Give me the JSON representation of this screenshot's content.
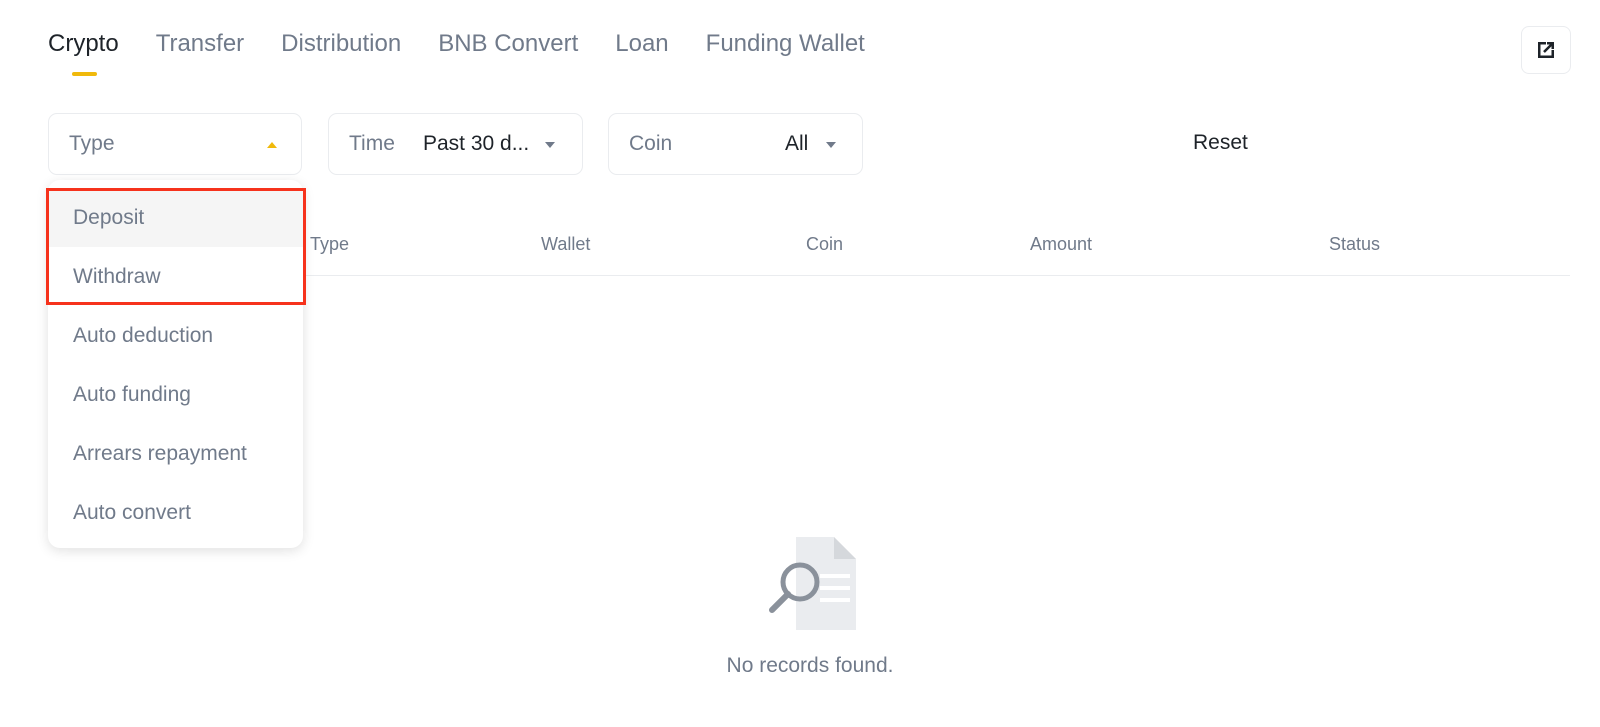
{
  "tabs": [
    {
      "label": "Crypto",
      "active": true
    },
    {
      "label": "Transfer",
      "active": false
    },
    {
      "label": "Distribution",
      "active": false
    },
    {
      "label": "BNB Convert",
      "active": false
    },
    {
      "label": "Loan",
      "active": false
    },
    {
      "label": "Funding Wallet",
      "active": false
    }
  ],
  "export": {
    "icon": "external-link-icon"
  },
  "filters": {
    "type": {
      "label": "Type",
      "icon": "caret-up-icon"
    },
    "time": {
      "label": "Time",
      "value": "Past 30 d...",
      "icon": "caret-down-icon"
    },
    "coin": {
      "label": "Coin",
      "value": "All",
      "icon": "caret-down-icon"
    }
  },
  "reset_label": "Reset",
  "table": {
    "columns": [
      "Type",
      "Wallet",
      "Coin",
      "Amount",
      "Status"
    ]
  },
  "empty_state": {
    "icon": "no-records-icon",
    "text": "No records found."
  },
  "type_dropdown": {
    "options": [
      "Deposit",
      "Withdraw",
      "Auto deduction",
      "Auto funding",
      "Arrears repayment",
      "Auto convert"
    ],
    "hovered": "Deposit"
  },
  "colors": {
    "accent": "#f0b90b",
    "highlight": "#f6321c",
    "muted": "#707a8a",
    "text": "#1e2329",
    "border": "#eaecef"
  }
}
